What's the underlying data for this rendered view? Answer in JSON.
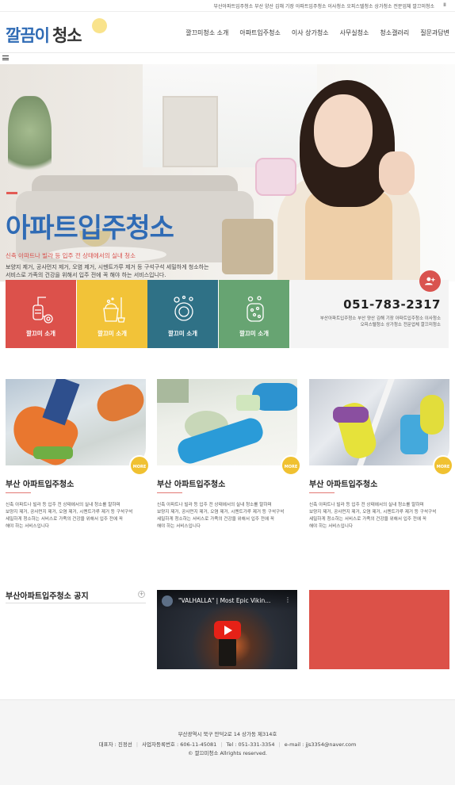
{
  "topbar": {
    "text": "부산아파트입주청소 부산 양산 김해 기장 아파트입주청소 이사청소 오피스텔청소 상가청소 전문업체 깔끄미청소",
    "pause_label": "II"
  },
  "header": {
    "logo_part1": "깔끔이",
    "logo_part2": "청소",
    "nav": [
      "깔끄미청소 소개",
      "아파트입주청소",
      "이사 상가청소",
      "사무실청소",
      "청소갤러리",
      "질문과답변"
    ]
  },
  "hero": {
    "title": "아파트입주청소",
    "subtitle": "신축 아파트나 빌라 등 입주 전 상태에서의 실내 청소",
    "desc_lines": [
      "보양지 제거, 공사먼지 제거, 오염 제거, 시멘트가루 제거 등 구석구석 세밀하게 청소하는",
      "서비스로 가족의 건강을 위해서 입주 전에 꼭 해야 하는 서비스입니다."
    ]
  },
  "services": [
    {
      "label": "깔끄미 소개",
      "color": "#dc514b",
      "icon": "vacuum-icon"
    },
    {
      "label": "깔끄미 소개",
      "color": "#f2c338",
      "icon": "bucket-mop-icon"
    },
    {
      "label": "깔끄미 소개",
      "color": "#2f7186",
      "icon": "sponge-bubbles-icon"
    },
    {
      "label": "깔끄미 소개",
      "color": "#67a472",
      "icon": "glove-sponge-icon"
    }
  ],
  "contact": {
    "phone": "051-783-2317",
    "desc_lines": [
      "부산아파트입주청소 부산 양산 김해 기장 아파트입주청소 이사청소",
      "오피스텔청소 상가청소 전문업체 깔끄미청소"
    ],
    "icon": "add-user-icon"
  },
  "cards": [
    {
      "title": "부산 아파트입주청소",
      "more": "MORE",
      "desc_lines": [
        "신축 아파트나 빌라 등 입주 전 상태에서의 실내 청소를 말하며",
        "보양지 제거, 공사먼지 제거, 오염 제거, 시멘트가루 제거 등 구석구석",
        "세밀하게 청소하는 서비스로 가족의 건강을 위해서 입주 전에 꼭",
        "해야 하는 서비스입니다"
      ]
    },
    {
      "title": "부산 아파트입주청소",
      "more": "MORE",
      "desc_lines": [
        "신축 아파트나 빌라 등 입주 전 상태에서의 실내 청소를 말하며",
        "보양지 제거, 공사먼지 제거, 오염 제거, 시멘트가루 제거 등 구석구석",
        "세밀하게 청소하는 서비스로 가족의 건강을 위해서 입주 전에 꼭",
        "해야 하는 서비스입니다"
      ]
    },
    {
      "title": "부산 아파트입주청소",
      "more": "MORE",
      "desc_lines": [
        "신축 아파트나 빌라 등 입주 전 상태에서의 실내 청소를 말하며",
        "보양지 제거, 공사먼지 제거, 오염 제거, 시멘트가루 제거 등 구석구석",
        "세밀하게 청소하는 서비스로 가족의 건강을 위해서 입주 전에 꼭",
        "해야 하는 서비스입니다"
      ]
    }
  ],
  "notice": {
    "title": "부산아파트입주청소 공지",
    "plus": "+"
  },
  "video": {
    "title": "\"VALHALLA\" | Most Epic Vikin...",
    "menu": "⋮"
  },
  "footer": {
    "address": "부산광역시 북구 만덕2로 14 상가동 제314호",
    "representative": "대표자 : 진정선",
    "business_no": "사업자등록번호 : 606-11-45081",
    "tel": "Tel : 051-331-3354",
    "email": "e-mail : jjs3354@naver.com",
    "copyright": "© 깔끄미청소 Allrights reserved."
  }
}
